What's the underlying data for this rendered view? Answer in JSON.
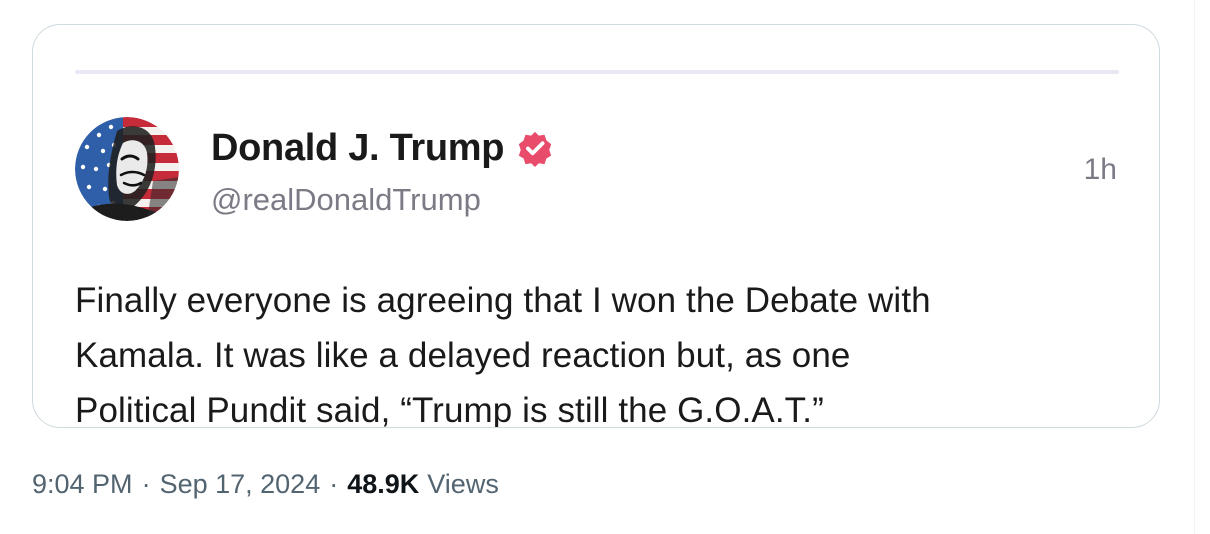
{
  "post": {
    "display_name": "Donald J. Trump",
    "handle": "@realDonaldTrump",
    "relative_time": "1h",
    "body": "Finally everyone is agreeing that I won the Debate with\nKamala. It was like a delayed reaction but, as one\nPolitical Pundit said, “Trump is still the G.O.A.T.”",
    "verified_icon": "verified-badge-icon",
    "verified_color": "#e94b6b",
    "avatar_icon": "american-flag-portrait-avatar"
  },
  "footer": {
    "time": "9:04 PM",
    "separator": "·",
    "date": "Sep 17, 2024",
    "views_count": "48.9K",
    "views_label": "Views"
  }
}
